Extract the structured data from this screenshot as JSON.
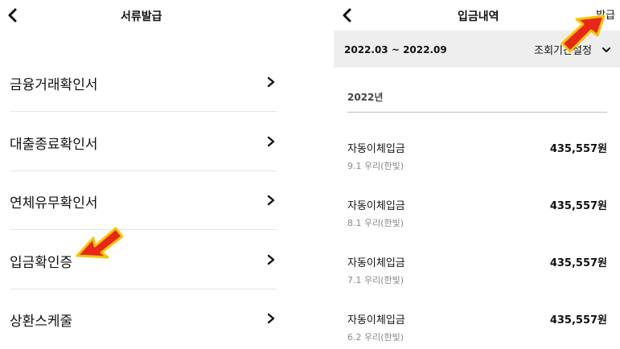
{
  "left_screen": {
    "header": {
      "title": "서류발급",
      "back_icon": "chevron-left-icon"
    },
    "menu_items": [
      {
        "label": "금융거래확인서"
      },
      {
        "label": "대출종료확인서"
      },
      {
        "label": "연체유무확인서"
      },
      {
        "label": "입금확인증"
      },
      {
        "label": "상환스케줄"
      }
    ],
    "chevron_icon": "chevron-right-icon"
  },
  "right_screen": {
    "header": {
      "title": "입금내역",
      "action_label": "발급",
      "back_icon": "chevron-left-icon"
    },
    "filter": {
      "range": "2022.03 ~ 2022.09",
      "period_button_label": "조회기간설정",
      "dropdown_icon": "chevron-down-icon"
    },
    "year": "2022년",
    "transactions": [
      {
        "type": "자동이체입금",
        "detail": "9.1 우리(한빛)",
        "amount": "435,557원"
      },
      {
        "type": "자동이체입금",
        "detail": "8.1 우리(한빛)",
        "amount": "435,557원"
      },
      {
        "type": "자동이체입금",
        "detail": "7.1 우리(한빛)",
        "amount": "435,557원"
      },
      {
        "type": "자동이체입금",
        "detail": "6.2 우리(한빛)",
        "amount": "435,557원"
      }
    ]
  },
  "annotations": {
    "arrow_color": "#e8261a",
    "arrow_outline": "#f5c400"
  }
}
